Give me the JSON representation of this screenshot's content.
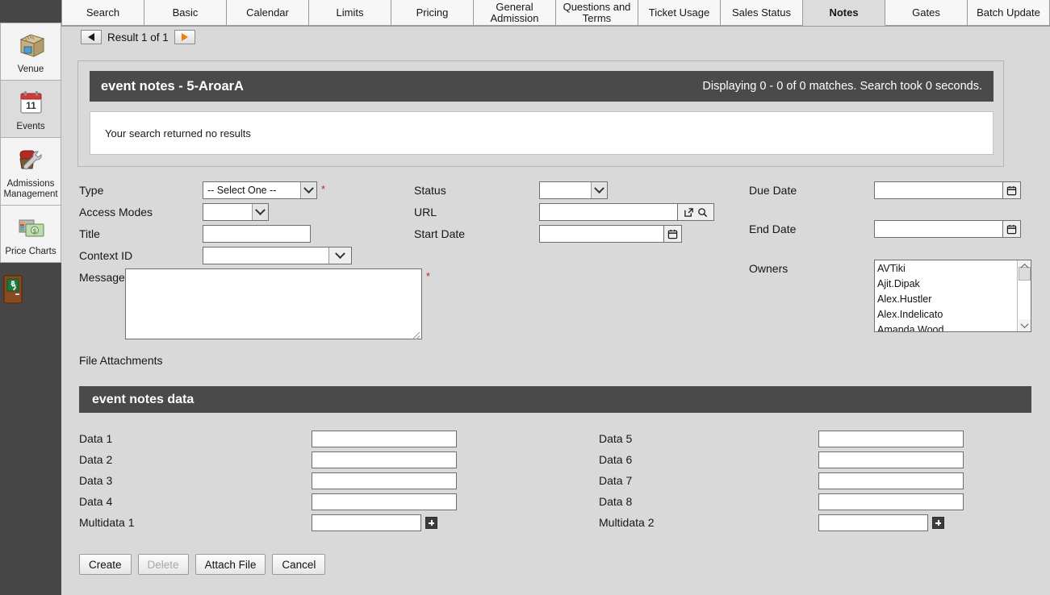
{
  "sidebar": {
    "items": [
      {
        "label": "Venue",
        "icon": "venue-box-icon",
        "active": false
      },
      {
        "label": "Events",
        "icon": "calendar-11-icon",
        "active": true
      },
      {
        "label": "Admissions Management",
        "icon": "wrench-chair-icon",
        "active": false
      },
      {
        "label": "Price Charts",
        "icon": "money-chart-icon",
        "active": false
      }
    ],
    "exit": {
      "label": "",
      "icon": "exit-door-icon"
    }
  },
  "tabs": [
    {
      "label": "Search",
      "active": false
    },
    {
      "label": "Basic",
      "active": false
    },
    {
      "label": "Calendar",
      "active": false
    },
    {
      "label": "Limits",
      "active": false
    },
    {
      "label": "Pricing",
      "active": false
    },
    {
      "label": "General Admission",
      "active": false
    },
    {
      "label": "Questions and Terms",
      "active": false
    },
    {
      "label": "Ticket Usage",
      "active": false
    },
    {
      "label": "Sales Status",
      "active": false
    },
    {
      "label": "Notes",
      "active": true
    },
    {
      "label": "Gates",
      "active": false
    },
    {
      "label": "Batch Update",
      "active": false
    }
  ],
  "result_nav": {
    "prev_icon": "triangle-left-icon",
    "next_icon": "triangle-right-icon",
    "text": "Result 1 of 1"
  },
  "search_panel": {
    "title": "event notes - 5-AroarA",
    "status": "Displaying 0 - 0 of 0 matches. Search took 0 seconds.",
    "no_results": "Your search returned no results"
  },
  "form": {
    "type": {
      "label": "Type",
      "value": "-- Select One --",
      "required": "*"
    },
    "access_modes": {
      "label": "Access Modes",
      "value": ""
    },
    "title": {
      "label": "Title",
      "value": "",
      "placeholder": ""
    },
    "context_id": {
      "label": "Context ID",
      "value": "",
      "placeholder": ""
    },
    "message": {
      "label": "Message",
      "value": "",
      "placeholder": "",
      "required": "*"
    },
    "status": {
      "label": "Status",
      "value": ""
    },
    "url": {
      "label": "URL",
      "value": "",
      "placeholder": "",
      "open_icon": "external-link-icon",
      "search_icon": "search-icon"
    },
    "start_date": {
      "label": "Start Date",
      "value": "",
      "placeholder": "",
      "icon": "calendar-icon"
    },
    "due_date": {
      "label": "Due Date",
      "value": "",
      "placeholder": "",
      "icon": "calendar-icon"
    },
    "end_date": {
      "label": "End Date",
      "value": "",
      "placeholder": "",
      "icon": "calendar-icon"
    },
    "owners": {
      "label": "Owners",
      "options": [
        "AVTiki",
        "Ajit.Dipak",
        "Alex.Hustler",
        "Alex.Indelicato",
        "Amanda.Wood"
      ]
    },
    "file_attachments_label": "File Attachments"
  },
  "data_section": {
    "title": "event notes data",
    "left": [
      {
        "label": "Data 1",
        "value": "",
        "multi": false
      },
      {
        "label": "Data 2",
        "value": "",
        "multi": false
      },
      {
        "label": "Data 3",
        "value": "",
        "multi": false
      },
      {
        "label": "Data 4",
        "value": "",
        "multi": false
      },
      {
        "label": "Multidata 1",
        "value": "",
        "multi": true
      }
    ],
    "right": [
      {
        "label": "Data 5",
        "value": "",
        "multi": false
      },
      {
        "label": "Data 6",
        "value": "",
        "multi": false
      },
      {
        "label": "Data 7",
        "value": "",
        "multi": false
      },
      {
        "label": "Data 8",
        "value": "",
        "multi": false
      },
      {
        "label": "Multidata 2",
        "value": "",
        "multi": true
      }
    ]
  },
  "buttons": [
    {
      "label": "Create",
      "disabled": false
    },
    {
      "label": "Delete",
      "disabled": true
    },
    {
      "label": "Attach File",
      "disabled": false
    },
    {
      "label": "Cancel",
      "disabled": false
    }
  ],
  "colors": {
    "page_bg": "#d9d9d9",
    "sidebar_bg": "#464646",
    "panel_header_bg": "#4a4a4a",
    "tab_active_bg": "#dcdcdc",
    "required_marker": "#d02020",
    "next_arrow": "#e8820c"
  }
}
